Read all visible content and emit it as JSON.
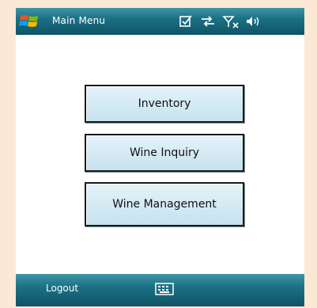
{
  "titlebar": {
    "title": "Main Menu",
    "status_icons": [
      "messaging-icon",
      "connectivity-icon",
      "signal-icon",
      "volume-icon"
    ]
  },
  "menu": {
    "buttons": [
      {
        "label": "Inventory"
      },
      {
        "label": "Wine Inquiry"
      },
      {
        "label": "Wine Management"
      }
    ]
  },
  "softkeys": {
    "left_label": "Logout",
    "center_icon": "keyboard-icon"
  },
  "colors": {
    "bar": "#1c7084",
    "button_fill": "#cfe7f2",
    "button_border": "#1a1a1a",
    "page_background": "#fbe9d6"
  }
}
